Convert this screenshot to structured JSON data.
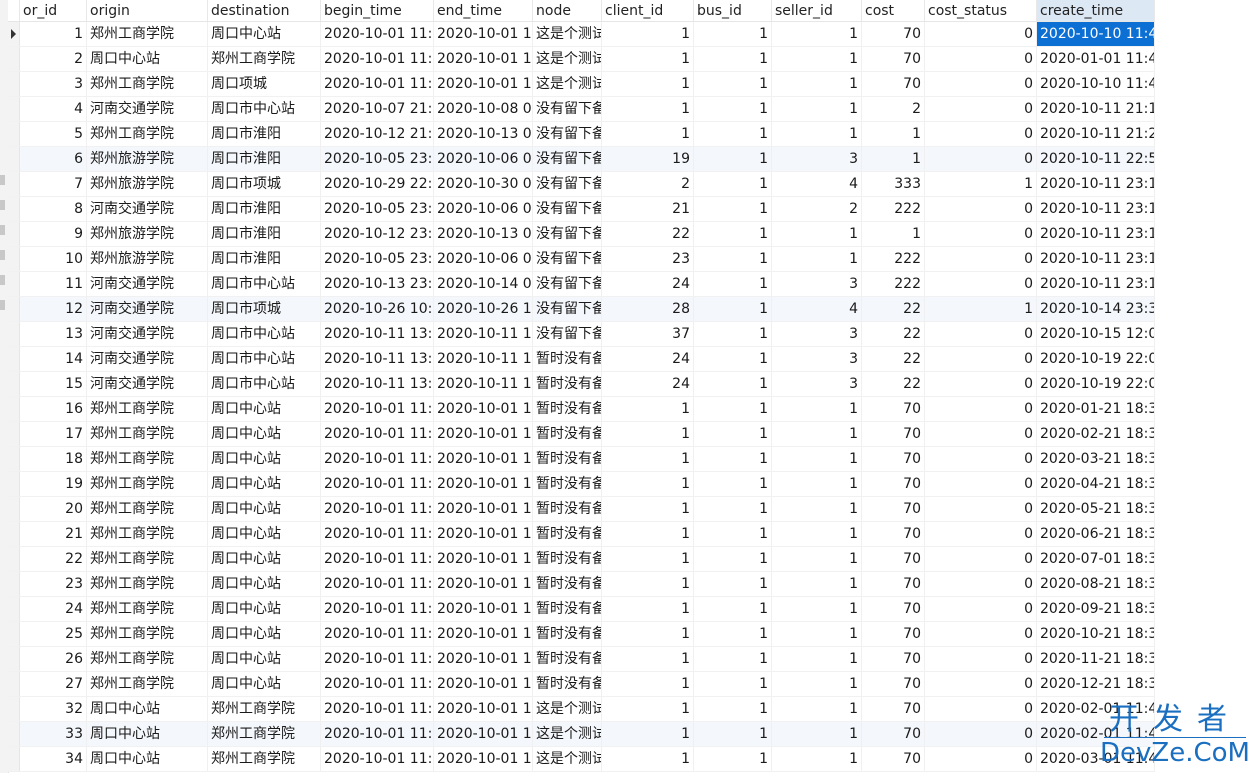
{
  "table": {
    "columns": [
      "or_id",
      "origin",
      "destination",
      "begin_time",
      "end_time",
      "node",
      "client_id",
      "bus_id",
      "seller_id",
      "cost",
      "cost_status",
      "create_time"
    ],
    "sorted_column": "create_time",
    "selected_cell": {
      "row": 0,
      "column": "create_time"
    },
    "rows": [
      [
        "1",
        "郑州工商学院",
        "周口中心站",
        "2020-10-01 11:",
        "2020-10-01 1",
        "这是个测试",
        "1",
        "1",
        "1",
        "70",
        "0",
        "2020-10-10 11:4"
      ],
      [
        "2",
        "周口中心站",
        "郑州工商学院",
        "2020-10-01 11:",
        "2020-10-01 1",
        "这是个测试",
        "1",
        "1",
        "1",
        "70",
        "0",
        "2020-01-01 11:4"
      ],
      [
        "3",
        "郑州工商学院",
        "周口项城",
        "2020-10-01 11:",
        "2020-10-01 1",
        "这是个测试",
        "1",
        "1",
        "1",
        "70",
        "0",
        "2020-10-10 11:4"
      ],
      [
        "4",
        "河南交通学院",
        "周口市中心站",
        "2020-10-07 21:",
        "2020-10-08 0",
        "没有留下备",
        "1",
        "1",
        "1",
        "2",
        "0",
        "2020-10-11 21:1"
      ],
      [
        "5",
        "郑州工商学院",
        "周口市淮阳",
        "2020-10-12 21:",
        "2020-10-13 0",
        "没有留下备",
        "1",
        "1",
        "1",
        "1",
        "0",
        "2020-10-11 21:2"
      ],
      [
        "6",
        "郑州旅游学院",
        "周口市淮阳",
        "2020-10-05 23:",
        "2020-10-06 0",
        "没有留下备",
        "19",
        "1",
        "3",
        "1",
        "0",
        "2020-10-11 22:5"
      ],
      [
        "7",
        "郑州旅游学院",
        "周口市项城",
        "2020-10-29 22:",
        "2020-10-30 0",
        "没有留下备",
        "2",
        "1",
        "4",
        "333",
        "1",
        "2020-10-11 23:1"
      ],
      [
        "8",
        "河南交通学院",
        "周口市淮阳",
        "2020-10-05 23:",
        "2020-10-06 0",
        "没有留下备",
        "21",
        "1",
        "2",
        "222",
        "0",
        "2020-10-11 23:1"
      ],
      [
        "9",
        "郑州旅游学院",
        "周口市淮阳",
        "2020-10-12 23:",
        "2020-10-13 0",
        "没有留下备",
        "22",
        "1",
        "1",
        "1",
        "0",
        "2020-10-11 23:1"
      ],
      [
        "10",
        "郑州旅游学院",
        "周口市淮阳",
        "2020-10-05 23:",
        "2020-10-06 0",
        "没有留下备",
        "23",
        "1",
        "1",
        "222",
        "0",
        "2020-10-11 23:1"
      ],
      [
        "11",
        "河南交通学院",
        "周口市中心站",
        "2020-10-13 23:",
        "2020-10-14 0",
        "没有留下备",
        "24",
        "1",
        "3",
        "222",
        "0",
        "2020-10-11 23:1"
      ],
      [
        "12",
        "河南交通学院",
        "周口市项城",
        "2020-10-26 10:",
        "2020-10-26 1",
        "没有留下备",
        "28",
        "1",
        "4",
        "22",
        "1",
        "2020-10-14 23:3"
      ],
      [
        "13",
        "河南交通学院",
        "周口市中心站",
        "2020-10-11 13:",
        "2020-10-11 1",
        "没有留下备",
        "37",
        "1",
        "3",
        "22",
        "0",
        "2020-10-15 12:0"
      ],
      [
        "14",
        "河南交通学院",
        "周口市中心站",
        "2020-10-11 13:",
        "2020-10-11 1",
        "暂时没有备",
        "24",
        "1",
        "3",
        "22",
        "0",
        "2020-10-19 22:0"
      ],
      [
        "15",
        "河南交通学院",
        "周口市中心站",
        "2020-10-11 13:",
        "2020-10-11 1",
        "暂时没有备",
        "24",
        "1",
        "3",
        "22",
        "0",
        "2020-10-19 22:0"
      ],
      [
        "16",
        "郑州工商学院",
        "周口中心站",
        "2020-10-01 11:",
        "2020-10-01 1",
        "暂时没有备",
        "1",
        "1",
        "1",
        "70",
        "0",
        "2020-01-21 18:3"
      ],
      [
        "17",
        "郑州工商学院",
        "周口中心站",
        "2020-10-01 11:",
        "2020-10-01 1",
        "暂时没有备",
        "1",
        "1",
        "1",
        "70",
        "0",
        "2020-02-21 18:3"
      ],
      [
        "18",
        "郑州工商学院",
        "周口中心站",
        "2020-10-01 11:",
        "2020-10-01 1",
        "暂时没有备",
        "1",
        "1",
        "1",
        "70",
        "0",
        "2020-03-21 18:3"
      ],
      [
        "19",
        "郑州工商学院",
        "周口中心站",
        "2020-10-01 11:",
        "2020-10-01 1",
        "暂时没有备",
        "1",
        "1",
        "1",
        "70",
        "0",
        "2020-04-21 18:3"
      ],
      [
        "20",
        "郑州工商学院",
        "周口中心站",
        "2020-10-01 11:",
        "2020-10-01 1",
        "暂时没有备",
        "1",
        "1",
        "1",
        "70",
        "0",
        "2020-05-21 18:3"
      ],
      [
        "21",
        "郑州工商学院",
        "周口中心站",
        "2020-10-01 11:",
        "2020-10-01 1",
        "暂时没有备",
        "1",
        "1",
        "1",
        "70",
        "0",
        "2020-06-21 18:3"
      ],
      [
        "22",
        "郑州工商学院",
        "周口中心站",
        "2020-10-01 11:",
        "2020-10-01 1",
        "暂时没有备",
        "1",
        "1",
        "1",
        "70",
        "0",
        "2020-07-01 18:3"
      ],
      [
        "23",
        "郑州工商学院",
        "周口中心站",
        "2020-10-01 11:",
        "2020-10-01 1",
        "暂时没有备",
        "1",
        "1",
        "1",
        "70",
        "0",
        "2020-08-21 18:3"
      ],
      [
        "24",
        "郑州工商学院",
        "周口中心站",
        "2020-10-01 11:",
        "2020-10-01 1",
        "暂时没有备",
        "1",
        "1",
        "1",
        "70",
        "0",
        "2020-09-21 18:3"
      ],
      [
        "25",
        "郑州工商学院",
        "周口中心站",
        "2020-10-01 11:",
        "2020-10-01 1",
        "暂时没有备",
        "1",
        "1",
        "1",
        "70",
        "0",
        "2020-10-21 18:3"
      ],
      [
        "26",
        "郑州工商学院",
        "周口中心站",
        "2020-10-01 11:",
        "2020-10-01 1",
        "暂时没有备",
        "1",
        "1",
        "1",
        "70",
        "0",
        "2020-11-21 18:3"
      ],
      [
        "27",
        "郑州工商学院",
        "周口中心站",
        "2020-10-01 11:",
        "2020-10-01 1",
        "暂时没有备",
        "1",
        "1",
        "1",
        "70",
        "0",
        "2020-12-21 18:3"
      ],
      [
        "32",
        "周口中心站",
        "郑州工商学院",
        "2020-10-01 11:",
        "2020-10-01 1",
        "这是个测试",
        "1",
        "1",
        "1",
        "70",
        "0",
        "2020-02-01 11:4"
      ],
      [
        "33",
        "周口中心站",
        "郑州工商学院",
        "2020-10-01 11:",
        "2020-10-01 1",
        "这是个测试",
        "1",
        "1",
        "1",
        "70",
        "0",
        "2020-02-01 11:4"
      ],
      [
        "34",
        "周口中心站",
        "郑州工商学院",
        "2020-10-01 11:",
        "2020-10-01 1",
        "这是个测试",
        "1",
        "1",
        "1",
        "70",
        "0",
        "2020-03-01 11:4"
      ]
    ]
  },
  "watermark": {
    "cn": "开发者",
    "en": "DevZe.CoM",
    "color": "#1a6fc0"
  },
  "colors": {
    "selection": "#0c6fd4",
    "sorted_header": "#dde8f5",
    "alt_row": "#f4f7fb"
  }
}
